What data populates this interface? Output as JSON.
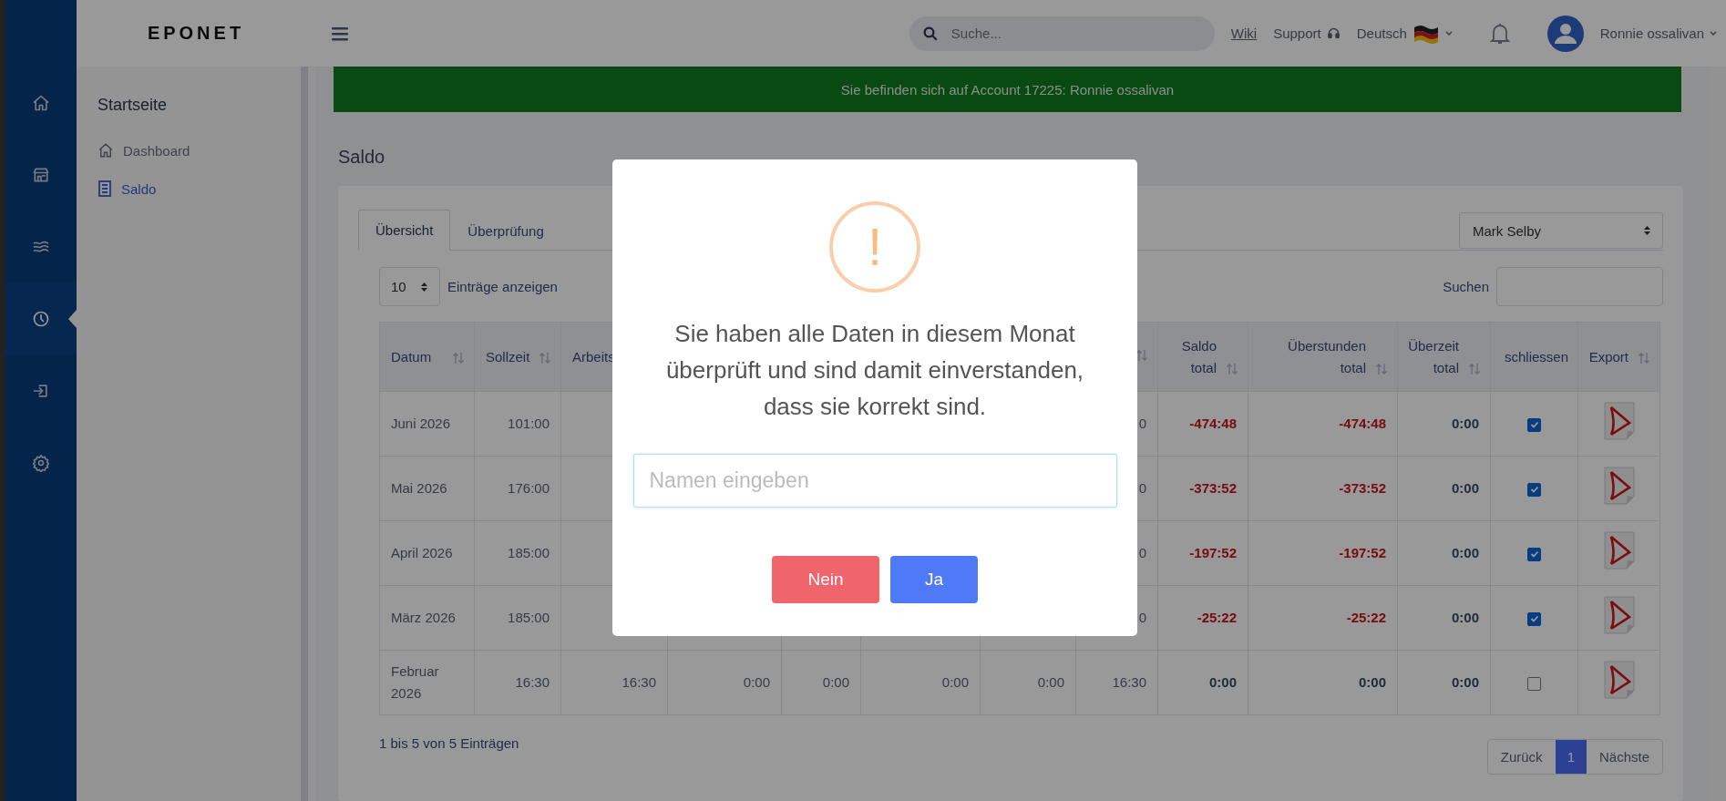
{
  "topbar": {
    "logo": "EPONET",
    "search": {
      "placeholder": "Suche..."
    },
    "wiki": "Wiki",
    "support": "Support",
    "language": "Deutsch",
    "user": "Ronnie ossalivan"
  },
  "rail": [
    {
      "selected": false
    },
    {
      "selected": false
    },
    {
      "selected": false
    },
    {
      "selected": true
    },
    {
      "selected": false
    },
    {
      "selected": false
    }
  ],
  "banner": "Sie befinden sich auf Account 17225: Ronnie ossalivan",
  "sidebar": {
    "heading": "Startseite",
    "items": [
      {
        "label": "Dashboard",
        "selected": false
      },
      {
        "label": "Saldo",
        "selected": true
      }
    ]
  },
  "page_title": "Saldo",
  "tabs": [
    {
      "label": "Übersicht",
      "selected": true
    },
    {
      "label": "Überprüfung",
      "selected": false
    }
  ],
  "employee_select": "Mark Selby",
  "length_select": {
    "value": "10",
    "label": "Einträge anzeigen"
  },
  "search_label": "Suchen",
  "table": {
    "columns": [
      {
        "label": "Datum",
        "sortable": true
      },
      {
        "label": "Sollzeit",
        "sortable": true
      },
      {
        "label": "Arbeits"
      },
      {},
      {},
      {},
      {},
      {
        "sortable": true
      },
      {
        "label": "Saldo total",
        "sortable": true
      },
      {
        "label": "Überstunden total",
        "sortable": true
      },
      {
        "label": "Überzeit total",
        "sortable": true
      },
      {
        "label": "schliessen",
        "sortable": false
      },
      {
        "label": "Export",
        "sortable": true
      }
    ],
    "rows": [
      {
        "cells": [
          "Juni 2026",
          "101:00",
          null,
          null,
          null,
          null,
          null,
          "0",
          "-474:48",
          "-474:48",
          "0:00"
        ],
        "negative": true,
        "closed": true
      },
      {
        "cells": [
          "Mai 2026",
          "176:00",
          null,
          null,
          null,
          null,
          null,
          "0",
          "-373:52",
          "-373:52",
          "0:00"
        ],
        "negative": true,
        "closed": true
      },
      {
        "cells": [
          "April 2026",
          "185:00",
          null,
          null,
          null,
          null,
          null,
          "0",
          "-197:52",
          "-197:52",
          "0:00"
        ],
        "negative": true,
        "closed": true
      },
      {
        "cells": [
          "März 2026",
          "185:00",
          null,
          null,
          null,
          null,
          null,
          "0",
          "-25:22",
          "-25:22",
          "0:00"
        ],
        "negative": true,
        "closed": true
      },
      {
        "cells": [
          "Februar 2026",
          "16:30",
          "16:30",
          "0:00",
          "0:00",
          "0:00",
          "0:00",
          "16:30",
          "0:00",
          "0:00",
          "0:00"
        ],
        "negative": false,
        "closed": false
      }
    ]
  },
  "info": "1 bis 5 von 5 Einträgen",
  "pagination": [
    {
      "label": "Zurück",
      "selected": false
    },
    {
      "label": "1",
      "selected": true
    },
    {
      "label": "Nächste",
      "selected": false
    }
  ],
  "modal": {
    "icon": "!",
    "message": "Sie haben alle Daten in diesem Monat überprüft und sind damit einverstanden, dass sie korrekt sind.",
    "input": {
      "placeholder": "Namen eingeben"
    },
    "buttons": [
      {
        "label": "Nein",
        "kind": "cancel"
      },
      {
        "label": "Ja",
        "kind": "confirm"
      }
    ]
  }
}
